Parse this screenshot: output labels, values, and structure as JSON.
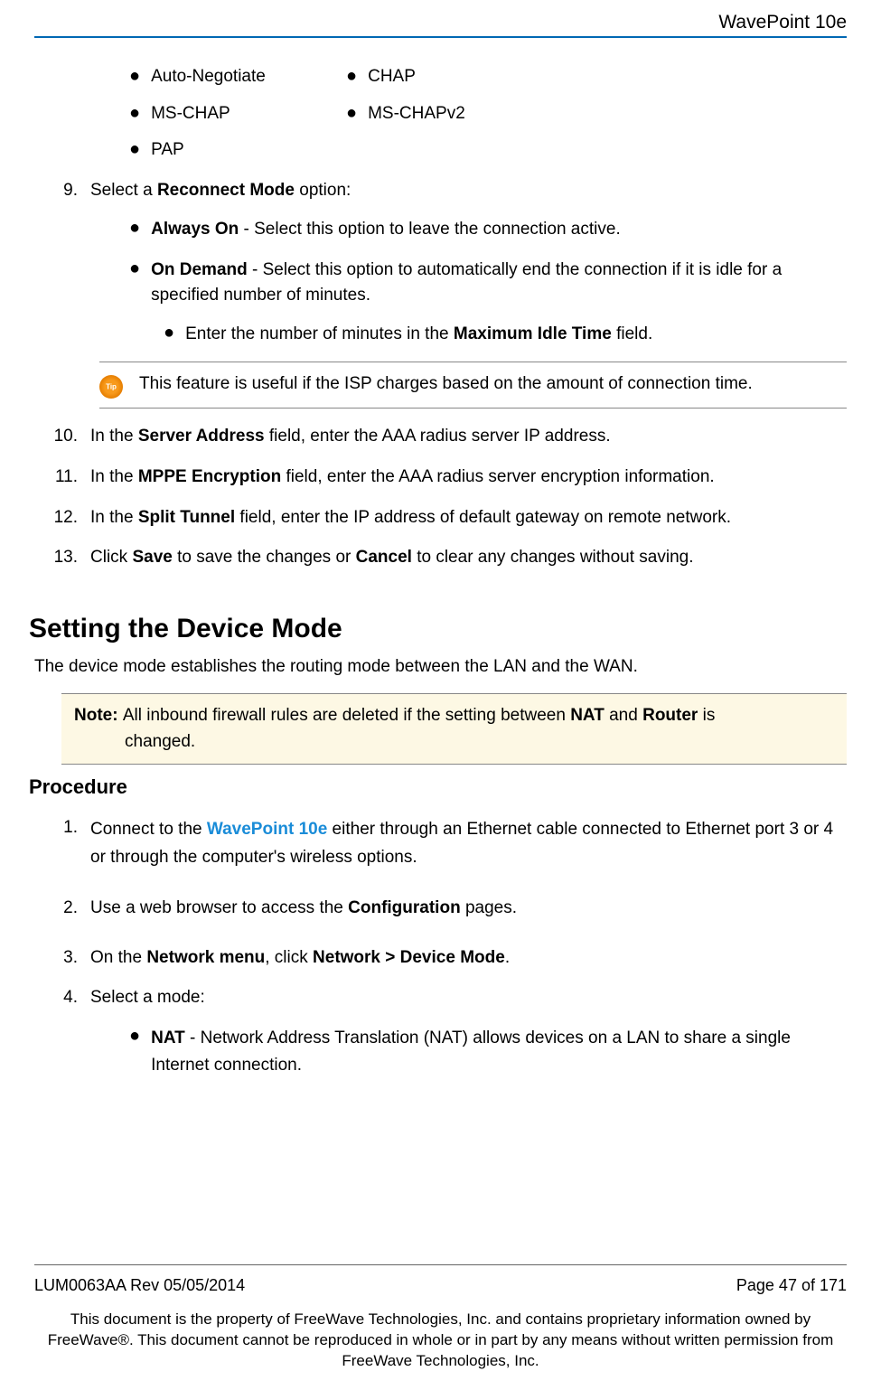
{
  "header": {
    "title": "WavePoint 10e"
  },
  "auth_options": {
    "rows": [
      [
        {
          "label": "Auto-Negotiate"
        },
        {
          "label": "CHAP"
        }
      ],
      [
        {
          "label": "MS-CHAP"
        },
        {
          "label": "MS-CHAPv2"
        }
      ],
      [
        {
          "label": "PAP"
        }
      ]
    ]
  },
  "step9": {
    "number": "9.",
    "pre": "Select a ",
    "bold": "Reconnect Mode",
    "post": " option:",
    "sub_always": {
      "bold": "Always On",
      "rest": " - Select this option to leave the connection active."
    },
    "sub_ondemand": {
      "bold": "On Demand",
      "rest": " - Select this option to automatically end the connection if it is idle for a specified number of minutes."
    },
    "sub_idle": {
      "pre": "Enter the number of minutes in the ",
      "bold": "Maximum Idle Time",
      "post": " field."
    }
  },
  "tip": {
    "text": "This feature is useful if the ISP charges based on the amount of connection time."
  },
  "step10": {
    "number": "10.",
    "pre": "In the ",
    "bold": "Server Address",
    "post": " field, enter the AAA radius server IP address."
  },
  "step11": {
    "number": "11.",
    "pre": "In the ",
    "bold": "MPPE Encryption",
    "post": " field, enter the AAA radius server encryption information."
  },
  "step12": {
    "number": "12.",
    "pre": "In the ",
    "bold": "Split Tunnel",
    "post": " field, enter the IP address of default gateway on remote network."
  },
  "step13": {
    "number": "13.",
    "pre": "Click ",
    "bold1": "Save",
    "mid": " to save the changes or ",
    "bold2": "Cancel",
    "post": " to clear any changes without saving."
  },
  "section": {
    "heading": "Setting the Device Mode",
    "intro": "The device mode establishes the routing mode between the LAN and the WAN."
  },
  "note": {
    "prefix": "Note: ",
    "pre": "All inbound firewall rules are deleted if the setting between ",
    "b1": "NAT",
    "mid": " and ",
    "b2": "Router",
    "post": " is",
    "line2": "changed."
  },
  "procedure": {
    "heading": "Procedure",
    "p1": {
      "number": "1.",
      "pre": "Connect to the ",
      "link": "WavePoint 10e",
      "post": " either through an Ethernet cable connected to Ethernet port 3 or 4 or through the computer's wireless options."
    },
    "p2": {
      "number": "2.",
      "pre": "Use a web browser to access the ",
      "bold": "Configuration",
      "post": " pages."
    },
    "p3": {
      "number": "3.",
      "pre": "On the ",
      "bold1": "Network menu",
      "mid": ", click ",
      "bold2": "Network > Device Mode",
      "post": "."
    },
    "p4": {
      "number": "4.",
      "text": "Select a mode:",
      "sub_nat": {
        "bold": "NAT",
        "rest": " - Network Address Translation (NAT) allows devices on a LAN to share a single Internet connection."
      }
    }
  },
  "footer": {
    "left": "LUM0063AA Rev 05/05/2014",
    "right": "Page 47 of 171",
    "info": "This document is the property of FreeWave Technologies, Inc. and contains proprietary information owned by FreeWave®. This document cannot be reproduced in whole or in part by any means without written permission from FreeWave Technologies, Inc."
  }
}
